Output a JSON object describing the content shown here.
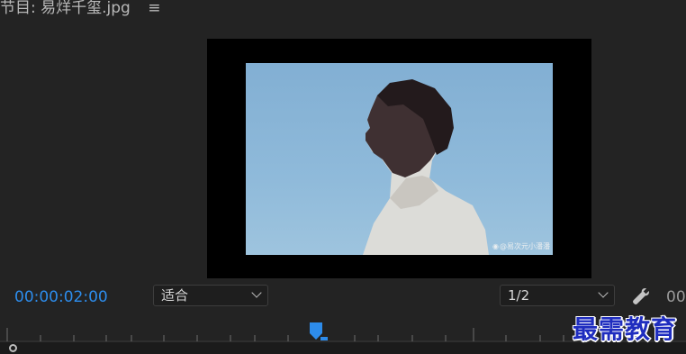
{
  "header": {
    "title": "节目: 易烊千玺.jpg",
    "menu_icon": "hamburger-menu-icon"
  },
  "preview": {
    "watermark_text": "@易次元小潘潘",
    "watermark_icon": "weibo-icon"
  },
  "controls": {
    "timecode": "00:00:02:00",
    "timecode_color": "#2d8ceb",
    "fit_select": "适合",
    "resolution_select": "1/2",
    "settings_icon": "wrench-icon",
    "end_timecode_partial": "00"
  },
  "timeline": {
    "playhead_icon": "playhead-marker-icon",
    "scroll_handle_icon": "scroll-handle-icon"
  },
  "brand": {
    "text": "最需教育",
    "color": "#1f2dbf"
  }
}
